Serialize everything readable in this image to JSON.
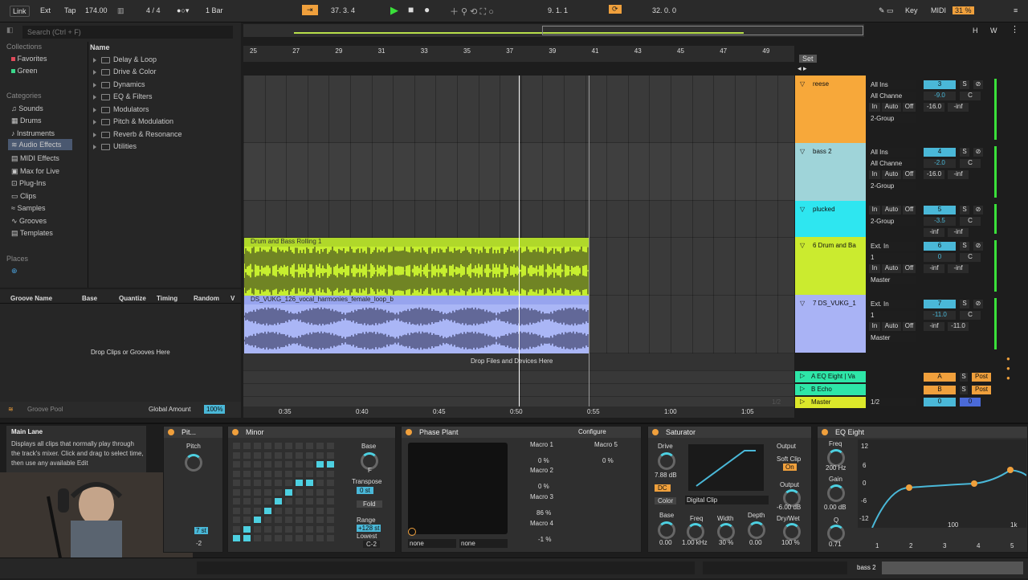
{
  "transport": {
    "link": "Link",
    "ext": "Ext",
    "tap": "Tap",
    "tempo": "174.00",
    "signature": "4 / 4",
    "quant": "1 Bar",
    "position": "37.   3.   4",
    "loop_start": "9.   1.   1",
    "loop_len": "32.   0.   0",
    "key": "Key",
    "midi": "MIDI",
    "cpu": "31 %"
  },
  "browser": {
    "search_placeholder": "Search (Ctrl + F)",
    "collections_title": "Collections",
    "collections": [
      "Favorites",
      "Green"
    ],
    "categories_title": "Categories",
    "categories": [
      "Sounds",
      "Drums",
      "Instruments",
      "Audio Effects",
      "MIDI Effects",
      "Max for Live",
      "Plug-Ins",
      "Clips",
      "Samples",
      "Grooves",
      "Templates"
    ],
    "places_title": "Places",
    "name_header": "Name",
    "folders": [
      "Delay & Loop",
      "Drive & Color",
      "Dynamics",
      "EQ & Filters",
      "Modulators",
      "Pitch & Modulation",
      "Reverb & Resonance",
      "Utilities"
    ]
  },
  "groove": {
    "headers": [
      "Groove Name",
      "Base",
      "Quantize",
      "Timing",
      "Random",
      "V"
    ],
    "drop_text": "Drop Clips or Grooves Here",
    "footer_label": "Groove Pool",
    "global_amount_label": "Global Amount",
    "global_amount": "100%"
  },
  "ruler": {
    "bars": [
      "25",
      "27",
      "29",
      "31",
      "33",
      "35",
      "37",
      "39",
      "41",
      "43",
      "45",
      "47",
      "49"
    ],
    "times": [
      "0:35",
      "0:40",
      "0:45",
      "0:50",
      "0:55",
      "1:00",
      "1:05"
    ],
    "set_label": "Set"
  },
  "arrangement": {
    "drop_text": "Drop Files and Devices Here",
    "clip_green_name": "Drum and Bass Rolling 1",
    "clip_blue_name": "DS_VUKG_126_vocal_harmonies_female_loop_b",
    "page": "1/2"
  },
  "tracks": [
    {
      "name": "reese",
      "color": "#f7a83a",
      "in": "All Ins",
      "ch": "All Channe",
      "group": "2-Group",
      "num": "3",
      "vol": "-9.0",
      "pan": "C",
      "send": "-16.0",
      "send2": "-inf"
    },
    {
      "name": "bass 2",
      "color": "#9fd4d9",
      "in": "All Ins",
      "ch": "All Channe",
      "group": "2-Group",
      "num": "4",
      "vol": "-2.0",
      "pan": "C",
      "send": "-16.0",
      "send2": "-inf"
    },
    {
      "name": "plucked",
      "color": "#2ee6f0",
      "in": "",
      "ch": "",
      "group": "2-Group",
      "num": "5",
      "vol": "-3.5",
      "pan": "C",
      "send": "-inf",
      "send2": "-inf"
    },
    {
      "name": "6 Drum and Ba",
      "color": "#cbeb2f",
      "in": "Ext. In",
      "ch": "1",
      "group": "Master",
      "num": "6",
      "vol": "0",
      "pan": "C",
      "send": "-inf",
      "send2": "-inf"
    },
    {
      "name": "7 DS_VUKG_1",
      "color": "#a9b3f5",
      "in": "Ext. In",
      "ch": "1",
      "group": "Master",
      "num": "7",
      "vol": "-11.0",
      "pan": "C",
      "send": "-inf",
      "send2": "-11.0"
    }
  ],
  "returns": [
    {
      "name": "A EQ Eight | Va",
      "letter": "A",
      "mode": "Post"
    },
    {
      "name": "B Echo",
      "letter": "B",
      "mode": "Post"
    },
    {
      "name": "Master",
      "letter": "1/2",
      "mode": ""
    }
  ],
  "mon": {
    "in": "In",
    "auto": "Auto",
    "off": "Off",
    "s": "S"
  },
  "info": {
    "title": "Main Lane",
    "text": "Displays all clips that normally play through the track's mixer. Click and drag to select time, then use any available Edit"
  },
  "devices": {
    "pitch": {
      "title": "Pit...",
      "label": "Pitch",
      "value": "7 st",
      "lowest": "-2"
    },
    "scale": {
      "title": "Minor",
      "base_label": "Base",
      "base": "F",
      "transpose_label": "Transpose",
      "transpose": "0 st",
      "fold": "Fold",
      "range_label": "Range",
      "range": "+128 st",
      "lowest_label": "Lowest",
      "lowest": "C-2"
    },
    "phase": {
      "title": "Phase Plant",
      "configure": "Configure",
      "macros": [
        {
          "name": "Macro 1",
          "value": "0 %"
        },
        {
          "name": "Macro 2",
          "value": "0 %"
        },
        {
          "name": "Macro 3",
          "value": "86 %"
        },
        {
          "name": "Macro 4",
          "value": "-1 %"
        },
        {
          "name": "Macro 5",
          "value": "0 %"
        }
      ],
      "sel1": "none",
      "sel2": "none"
    },
    "saturator": {
      "title": "Saturator",
      "drive_label": "Drive",
      "drive": "7.88 dB",
      "dc": "DC",
      "color": "Color",
      "type": "Digital Clip",
      "output_label": "Output",
      "soft_clip": "Soft Clip",
      "on": "On",
      "output": "-6.00 dB",
      "drywet_label": "Dry/Wet",
      "drywet": "100 %",
      "base_label": "Base",
      "base": "0.00",
      "freq_label": "Freq",
      "freq": "1.00 kHz",
      "width_label": "Width",
      "width": "30 %",
      "depth_label": "Depth",
      "depth": "0.00"
    },
    "eq": {
      "title": "EQ Eight",
      "freq_label": "Freq",
      "freq": "200 Hz",
      "gain_label": "Gain",
      "gain": "0.00 dB",
      "q_label": "Q",
      "q": "0.71",
      "db_ticks": [
        "12",
        "6",
        "0",
        "-6",
        "-12"
      ],
      "freq_ticks": [
        "100",
        "1k"
      ],
      "bands": [
        "1",
        "2",
        "3",
        "4",
        "5"
      ]
    }
  },
  "status": {
    "track": "bass 2"
  }
}
